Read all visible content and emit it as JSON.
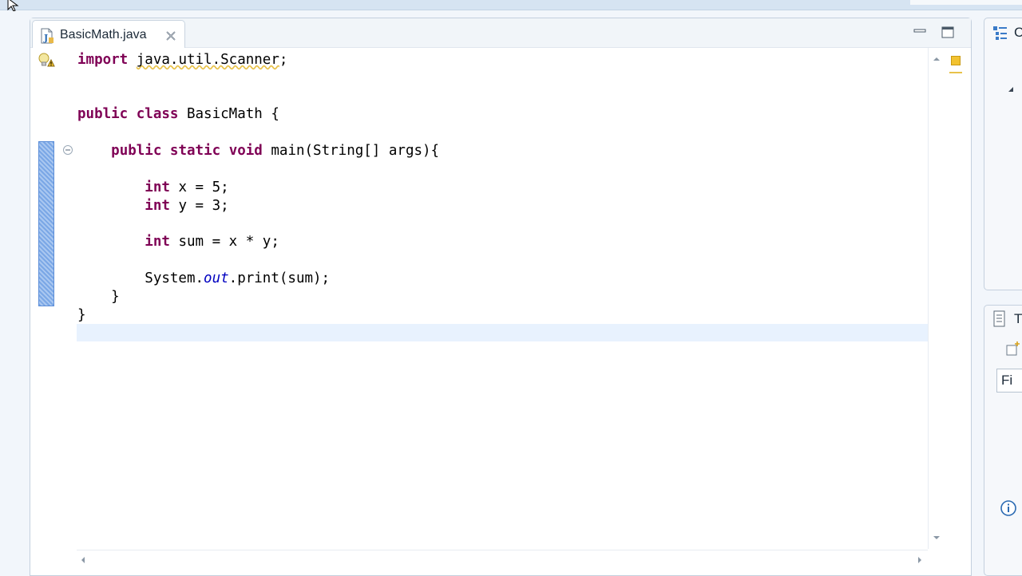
{
  "editor": {
    "tab": {
      "label": "BasicMath.java",
      "icon": "java-file-icon",
      "close_icon": "close-icon"
    },
    "controls": {
      "minimize_icon": "minimize-icon",
      "maximize_icon": "maximize-icon"
    },
    "gutter": {
      "warning_icon": "warning-lightbulb-icon",
      "fold_icon": "fold-collapse-icon"
    },
    "code_lines": [
      "import java.util.Scanner;",
      "",
      "public class BasicMath {",
      "",
      "    public static void main(String[] args){",
      "",
      "        int x = 5;",
      "        int y = 3;",
      "",
      "        int sum = x * y;",
      "",
      "        System.out.print(sum);",
      "    }",
      "}",
      ""
    ]
  },
  "right_panel": {
    "outline_tab_text": "C",
    "outline_icon": "outline-icon",
    "task_tab_text": "T",
    "task_icon": "task-list-icon",
    "new_task_icon": "new-task-icon",
    "find_placeholder": "Fi",
    "info_icon": "info-icon"
  },
  "colors": {
    "keyword": "#7f0055",
    "static_field": "#0000c0",
    "current_line": "#e8f2fe",
    "change_bar": "#7aa7e6",
    "warning": "#e8c24a"
  }
}
